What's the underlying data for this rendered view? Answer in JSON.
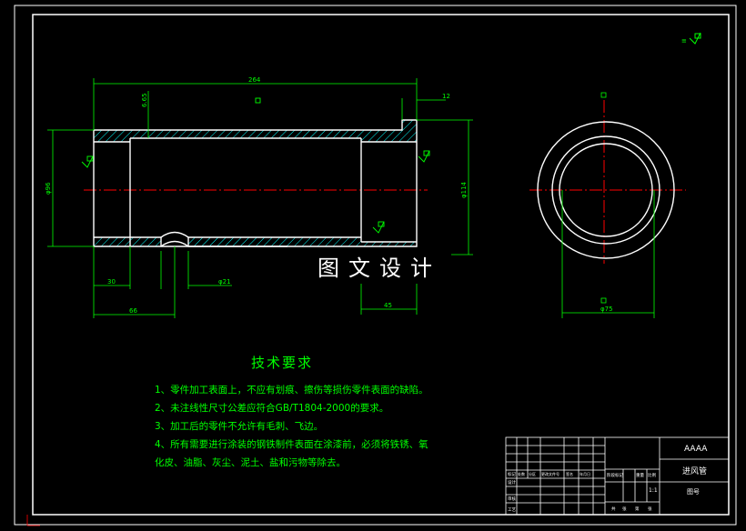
{
  "drawing": {
    "dimensions": {
      "overall_length": "264",
      "wall_thickness": "6.65",
      "flange_step": "12",
      "bore_diameter": "φ96",
      "outer_diameter": "φ114",
      "left_counterbore": "30",
      "hole_position": "66",
      "hole_diameter": "φ21",
      "right_counterbore": "45",
      "end_view_diameter": "φ75"
    },
    "watermark": "图文设计",
    "technical_requirements": {
      "title": "技术要求",
      "items": [
        "1、零件加工表面上，不应有划痕、擦伤等损伤零件表面的缺陷。",
        "2、未注线性尺寸公差应符合GB/T1804-2000的要求。",
        "3、加工后的零件不允许有毛刺、飞边。",
        "4、所有需要进行涂装的钢铁制件表面在涂漆前，必须将铁锈、氧",
        "化皮、油脂、灰尘、泥土、盐和污物等除去。"
      ]
    },
    "title_block": {
      "company": "AAAA",
      "part_name": "进风管",
      "drawing_no_label": "图号",
      "scale": "1:1",
      "row_labels": [
        "标记",
        "设计",
        "审核",
        "工艺"
      ],
      "header_labels": [
        "处数",
        "分区",
        "更改文件号",
        "签名",
        "年月日"
      ],
      "stage_labels": [
        "阶段标记",
        "重量",
        "比例"
      ],
      "sheet_labels": [
        "共",
        "张",
        "第",
        "张"
      ]
    },
    "colors": {
      "outline": "#ffffff",
      "dimension": "#00ff00",
      "centerline": "#ff0000",
      "hatch": "#00ffff",
      "frame": "#ffffff",
      "background": "#000000"
    }
  }
}
